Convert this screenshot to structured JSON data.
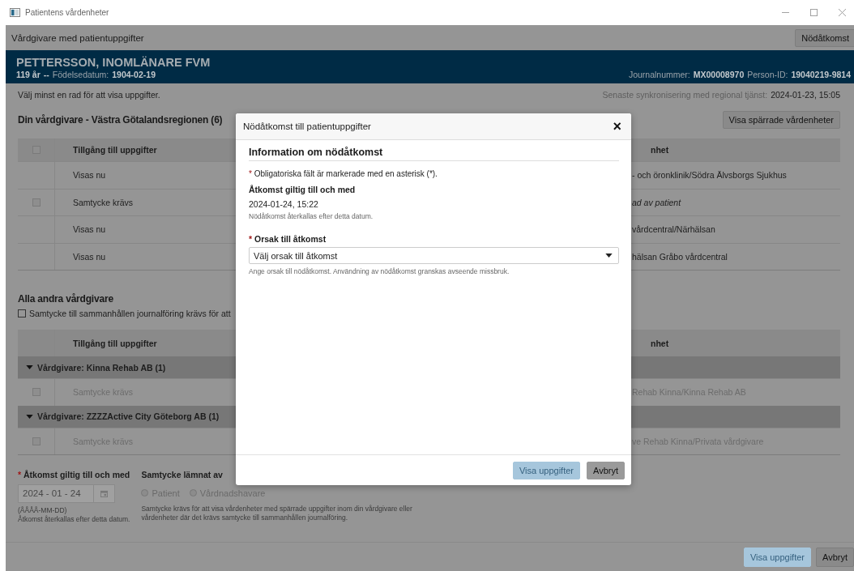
{
  "window": {
    "title": "Patientens vårdenheter"
  },
  "toolbar": {
    "title": "Vårdgivare med patientuppgifter",
    "emergency_button": "Nödåtkomst"
  },
  "patient": {
    "name": "PETTERSSON, INOMLÄNARE FVM",
    "age": "119 år",
    "separator": "--",
    "birth_label": "Födelsedatum:",
    "birth_date": "1904-02-19",
    "journal_label": "Journalnummer:",
    "journal_number": "MX00008970",
    "id_label": "Person-ID:",
    "person_id": "19040219-9814"
  },
  "instruction": "Välj minst en rad för att visa uppgifter.",
  "sync": {
    "label": "Senaste synkronisering med regional tjänst:",
    "value": "2024-01-23, 15:05"
  },
  "own_provider": {
    "title": "Din vårdgivare - Västra Götalandsregionen (6)",
    "show_blocked_button": "Visa spärrade vårdenheter",
    "header_checked": false,
    "columns": [
      "Tillgång till uppgifter",
      "nhet"
    ],
    "rows": [
      {
        "kind": "shown",
        "access": "Visas nu",
        "unit": "- och öronklinik/Södra Älvsborgs Sjukhus"
      },
      {
        "kind": "consent",
        "checked": false,
        "access": "Samtycke krävs",
        "unit": "ad av patient"
      },
      {
        "kind": "shown",
        "access": "Visas nu",
        "unit": "vårdcentral/Närhälsan"
      },
      {
        "kind": "shown",
        "access": "Visas nu",
        "unit": "hälsan Gråbo vårdcentral"
      }
    ]
  },
  "other_providers": {
    "title": "Alla andra vårdgivare",
    "consent_checkbox": {
      "label": "Samtycke till sammanhållen journalföring krävs för att",
      "checked": false
    },
    "columns": [
      "Tillgång till uppgifter",
      "nhet"
    ],
    "groups": [
      {
        "title": "Vårdgivare: Kinna Rehab AB (1)",
        "expanded": true,
        "rows": [
          {
            "kind": "disabled",
            "checked": false,
            "access": "Samtycke krävs",
            "unit": "Rehab Kinna/Kinna Rehab AB"
          }
        ]
      },
      {
        "title": "Vårdgivare: ZZZZActive City Göteborg AB (1)",
        "expanded": true,
        "rows": [
          {
            "kind": "disabled",
            "checked": false,
            "access": "Samtycke krävs",
            "unit": "ve Rehab Kinna/Privata vårdgivare"
          }
        ]
      }
    ]
  },
  "access_date": {
    "required_mark": "*",
    "label": "Åtkomst giltig till och med",
    "value": "2024 - 01 - 24",
    "disabled": true,
    "format": "(ÅÅÅÅ-MM-DD)",
    "hint": "Åtkomst återkallas efter detta datum."
  },
  "consent": {
    "label": "Samtycke lämnat av",
    "disabled": true,
    "options": [
      {
        "label": "Patient",
        "selected": false
      },
      {
        "label": "Vårdnadshavare",
        "selected": false
      }
    ],
    "hint": "Samtycke krävs för att visa vårdenheter med spärrade uppgifter inom din vårdgivare eller vårdenheter där det krävs samtycke till sammanhållen journalföring."
  },
  "footer_buttons": [
    {
      "label": "Visa uppgifter",
      "kind": "primary",
      "disabled": true
    },
    {
      "label": "Avbryt",
      "kind": "secondary",
      "disabled": false
    }
  ],
  "dialog": {
    "title": "Nödåtkomst till patientuppgifter",
    "close": "×",
    "section_title": "Information om nödåtkomst",
    "required_mark": "*",
    "required_note": "Obligatoriska fält är markerade med en asterisk (*).",
    "valid_label": "Åtkomst giltig till och med",
    "valid_value": "2024-01-24, 15:22",
    "valid_hint": "Nödåtkomst återkallas efter detta datum.",
    "reason": {
      "required_mark": "*",
      "label": "Orsak till åtkomst",
      "value": "Välj orsak till åtkomst",
      "hint": "Ange orsak till nödåtkomst. Användning av nödåtkomst granskas avseende missbruk."
    },
    "buttons": [
      {
        "label": "Visa uppgifter",
        "kind": "primary",
        "disabled": true
      },
      {
        "label": "Avbryt",
        "kind": "secondary",
        "disabled": false
      }
    ]
  }
}
